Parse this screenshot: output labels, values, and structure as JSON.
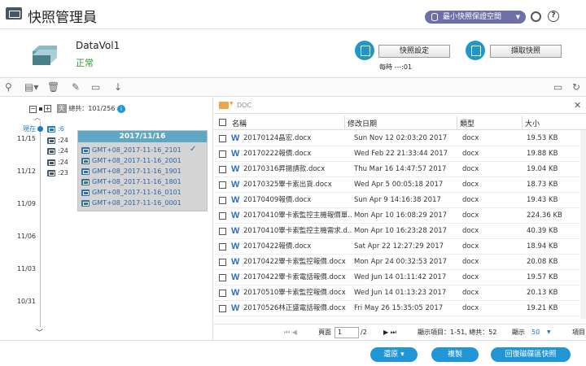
{
  "app": {
    "title": "快照管理員",
    "min_space_label": "最小快照保證空間"
  },
  "volume": {
    "name": "DataVol1",
    "status": "正常"
  },
  "actions": {
    "snapshot_settings": "快照設定",
    "take_snapshot": "擷取快照",
    "schedule_text": "每時 ---:01"
  },
  "timeline": {
    "summary_prefix": "總共：",
    "summary_value": "101/256",
    "day_label": "天",
    "now_label": "現在",
    "dates": [
      "11/15",
      "11/12",
      "11/09",
      "11/06",
      "11/03",
      "10/31"
    ],
    "snapshots": [
      ":6",
      ":24",
      ":24",
      ":24",
      ":23"
    ]
  },
  "popup": {
    "date": "2017/11/16",
    "items": [
      "GMT+08_2017-11-16_2101",
      "GMT+08_2017-11-16_2001",
      "GMT+08_2017-11-16_1901",
      "GMT+08_2017-11-16_1801",
      "GMT+08_2017-11-16_0101",
      "GMT+08_2017-11-16_0001"
    ]
  },
  "file_browser": {
    "path": "DOC",
    "columns": {
      "name": "名稱",
      "date": "修改日期",
      "type": "類型",
      "size": "大小"
    },
    "files": [
      {
        "name": "20170124晶宏.docx",
        "date": "Sun Nov 12 02:03:20 2017",
        "type": "docx",
        "size": "19.53 KB"
      },
      {
        "name": "20170222報價.docx",
        "date": "Wed Feb 22 21:33:44 2017",
        "type": "docx",
        "size": "19.88 KB"
      },
      {
        "name": "20170316昇揚請款.docx",
        "date": "Thu Mar 16 14:47:57 2017",
        "type": "docx",
        "size": "19.04 KB"
      },
      {
        "name": "20170325畢卡索出貨.docx",
        "date": "Wed Apr 5 00:05:18 2017",
        "type": "docx",
        "size": "18.73 KB"
      },
      {
        "name": "20170409報價.docx",
        "date": "Sun Apr 9 14:16:38 2017",
        "type": "docx",
        "size": "19.43 KB"
      },
      {
        "name": "20170410畢卡索監控主機報價單...",
        "date": "Mon Apr 10 16:08:29 2017",
        "type": "docx",
        "size": "224.36 KB"
      },
      {
        "name": "20170410畢卡索監控主機需求.d...",
        "date": "Mon Apr 10 16:23:28 2017",
        "type": "docx",
        "size": "40.39 KB"
      },
      {
        "name": "20170422報價.docx",
        "date": "Sat Apr 22 12:27:29 2017",
        "type": "docx",
        "size": "18.94 KB"
      },
      {
        "name": "20170422畢卡索監控報價.docx",
        "date": "Mon Apr 24 00:32:53 2017",
        "type": "docx",
        "size": "20.08 KB"
      },
      {
        "name": "20170422畢卡索電話報價.docx",
        "date": "Wed Jun 14 01:11:42 2017",
        "type": "docx",
        "size": "19.57 KB"
      },
      {
        "name": "20170510畢卡索監控報價.docx",
        "date": "Wed Jun 14 01:13:23 2017",
        "type": "docx",
        "size": "20.13 KB"
      },
      {
        "name": "20170526林正盛電話報價.docx",
        "date": "Fri May 26 15:35:05 2017",
        "type": "docx",
        "size": "19.21 KB"
      }
    ],
    "pager": {
      "page_label": "頁面",
      "page_value": "1",
      "page_total": "/2",
      "display_label": "顯示項目：1-51, 總共：52",
      "show_label": "顯示",
      "show_value": "50",
      "items_label": "項目"
    }
  },
  "footer": {
    "restore": "還原",
    "copy": "複製",
    "recover": "回復磁碟區快照"
  }
}
